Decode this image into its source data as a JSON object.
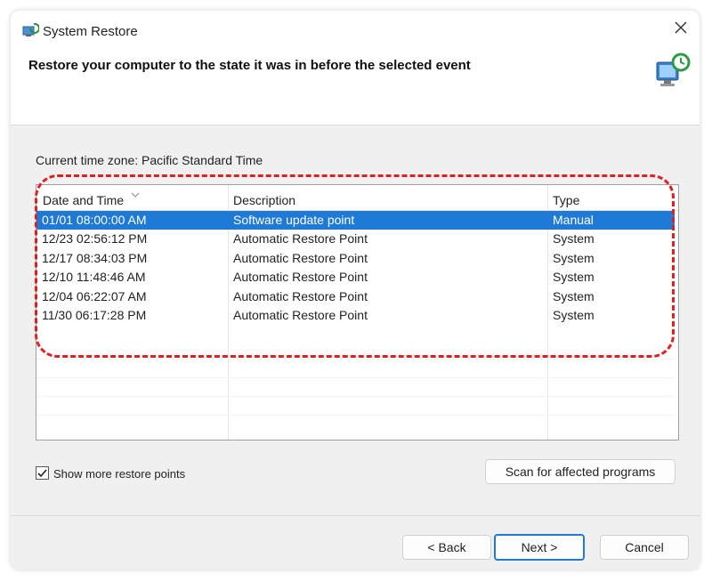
{
  "window": {
    "title": "System Restore",
    "headline": "Restore your computer to the state it was in before the selected event",
    "close_icon": "close-icon",
    "app_icon": "system-restore-icon",
    "hero_icon": "restore-computer-icon"
  },
  "timezone_label": "Current time zone: Pacific Standard Time",
  "table": {
    "columns": [
      "Date and Time",
      "Description",
      "Type"
    ],
    "rows": [
      {
        "datetime": "01/01 08:00:00 AM",
        "description": "Software update point",
        "type": "Manual",
        "selected": true
      },
      {
        "datetime": "12/23 02:56:12 PM",
        "description": "Automatic Restore Point",
        "type": "System",
        "selected": false
      },
      {
        "datetime": "12/17 08:34:03 PM",
        "description": "Automatic Restore Point",
        "type": "System",
        "selected": false
      },
      {
        "datetime": "12/10 11:48:46 AM",
        "description": "Automatic Restore Point",
        "type": "System",
        "selected": false
      },
      {
        "datetime": "12/04 06:22:07 AM",
        "description": "Automatic Restore Point",
        "type": "System",
        "selected": false
      },
      {
        "datetime": "11/30 06:17:28 PM",
        "description": "Automatic Restore Point",
        "type": "System",
        "selected": false
      }
    ]
  },
  "show_more": {
    "label": "Show more restore points",
    "checked": true
  },
  "buttons": {
    "scan": "Scan for affected programs",
    "back": "< Back",
    "next": "Next >",
    "cancel": "Cancel"
  },
  "colors": {
    "selection": "#1e7ad6",
    "highlight_annotation": "#e02020"
  }
}
